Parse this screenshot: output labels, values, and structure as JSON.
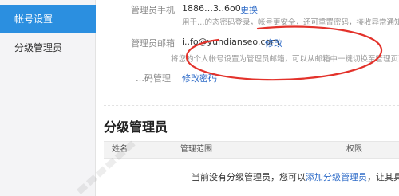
{
  "sidebar": {
    "items": [
      {
        "label": "帐号设置",
        "active": true
      },
      {
        "label": "分级管理员",
        "active": false
      }
    ]
  },
  "settings": {
    "phone": {
      "label": "管理员手机",
      "value": "1886…3..6o0",
      "action": "更换",
      "hint": "用于…的态密码登录，帐号更安全，还可重置密码，接收异常通知。"
    },
    "email": {
      "label": "管理员邮箱",
      "value": "i..fo@yundianseo.com",
      "action": "修改",
      "hint": "将您的个人帐号设置为管理员邮箱，可以从邮箱中一键切换至管理页面。"
    },
    "password": {
      "label": "…码管理",
      "action": "修改密码"
    }
  },
  "sub_admin": {
    "title": "分级管理员",
    "columns": [
      "姓名",
      "管理范围",
      "权限"
    ],
    "empty_prefix": "当前没有分级管理员，您可以",
    "empty_link": "添加分级管理员",
    "empty_suffix": "，让其具有部"
  },
  "colors": {
    "accent": "#2b8fe0",
    "link": "#2f6cc8",
    "annotation": "#e3322b"
  }
}
